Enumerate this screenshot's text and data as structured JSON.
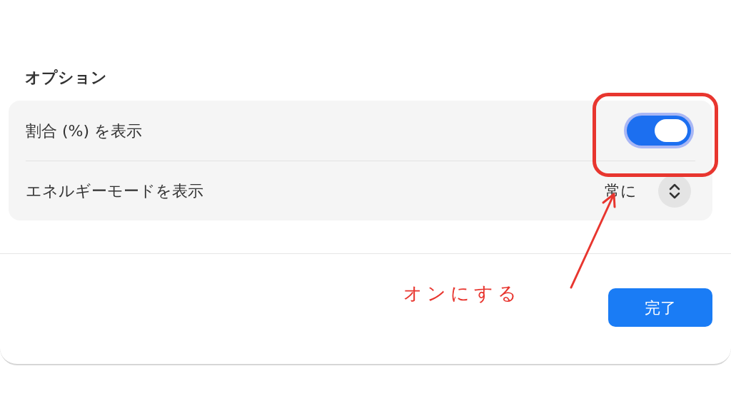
{
  "options": {
    "title": "オプション",
    "rows": [
      {
        "kind": "toggle",
        "label": "割合 (%) を表示",
        "on": true
      },
      {
        "kind": "popup",
        "label": "エネルギーモードを表示",
        "value": "常に"
      }
    ]
  },
  "done_button": "完了",
  "annotation": {
    "text": "オンにする"
  }
}
